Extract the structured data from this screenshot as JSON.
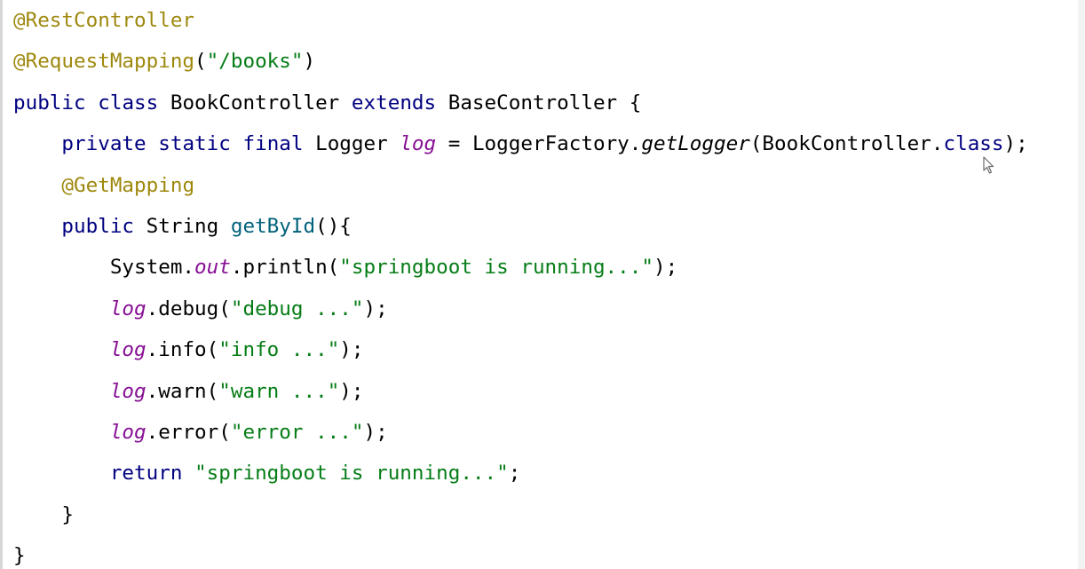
{
  "editor": {
    "lines": [
      [
        {
          "t": "@RestController",
          "c": "ann"
        }
      ],
      [
        {
          "t": "@RequestMapping",
          "c": "ann"
        },
        {
          "t": "(",
          "c": ""
        },
        {
          "t": "\"/books\"",
          "c": "str"
        },
        {
          "t": ")",
          "c": ""
        }
      ],
      [
        {
          "t": "public",
          "c": "kw"
        },
        {
          "t": " ",
          "c": ""
        },
        {
          "t": "class",
          "c": "kw"
        },
        {
          "t": " BookController ",
          "c": ""
        },
        {
          "t": "extends",
          "c": "kw"
        },
        {
          "t": " BaseController {",
          "c": ""
        }
      ],
      [
        {
          "t": "    ",
          "c": ""
        },
        {
          "t": "private",
          "c": "kw"
        },
        {
          "t": " ",
          "c": ""
        },
        {
          "t": "static",
          "c": "kw"
        },
        {
          "t": " ",
          "c": ""
        },
        {
          "t": "final",
          "c": "kw"
        },
        {
          "t": " Logger ",
          "c": ""
        },
        {
          "t": "log",
          "c": "fld"
        },
        {
          "t": " = LoggerFactory.",
          "c": ""
        },
        {
          "t": "getLogger",
          "c": "itl"
        },
        {
          "t": "(BookController.",
          "c": ""
        },
        {
          "t": "class",
          "c": "kw"
        },
        {
          "t": ");",
          "c": ""
        }
      ],
      [
        {
          "t": "    ",
          "c": ""
        },
        {
          "t": "@GetMapping",
          "c": "ann"
        }
      ],
      [
        {
          "t": "    ",
          "c": ""
        },
        {
          "t": "public",
          "c": "kw"
        },
        {
          "t": " String ",
          "c": ""
        },
        {
          "t": "getById",
          "c": "mth"
        },
        {
          "t": "(){",
          "c": ""
        }
      ],
      [
        {
          "t": "        System.",
          "c": ""
        },
        {
          "t": "out",
          "c": "fld"
        },
        {
          "t": ".println(",
          "c": ""
        },
        {
          "t": "\"springboot is running...\"",
          "c": "str"
        },
        {
          "t": ");",
          "c": ""
        }
      ],
      [
        {
          "t": "        ",
          "c": ""
        },
        {
          "t": "log",
          "c": "fld"
        },
        {
          "t": ".debug(",
          "c": ""
        },
        {
          "t": "\"debug ...\"",
          "c": "str"
        },
        {
          "t": ");",
          "c": ""
        }
      ],
      [
        {
          "t": "        ",
          "c": ""
        },
        {
          "t": "log",
          "c": "fld"
        },
        {
          "t": ".info(",
          "c": ""
        },
        {
          "t": "\"info ...\"",
          "c": "str"
        },
        {
          "t": ");",
          "c": ""
        }
      ],
      [
        {
          "t": "        ",
          "c": ""
        },
        {
          "t": "log",
          "c": "fld"
        },
        {
          "t": ".warn(",
          "c": ""
        },
        {
          "t": "\"warn ...\"",
          "c": "str"
        },
        {
          "t": ");",
          "c": ""
        }
      ],
      [
        {
          "t": "        ",
          "c": ""
        },
        {
          "t": "log",
          "c": "fld"
        },
        {
          "t": ".error(",
          "c": ""
        },
        {
          "t": "\"error ...\"",
          "c": "str"
        },
        {
          "t": ");",
          "c": ""
        }
      ],
      [
        {
          "t": "        ",
          "c": ""
        },
        {
          "t": "return",
          "c": "kw"
        },
        {
          "t": " ",
          "c": ""
        },
        {
          "t": "\"springboot is running...\"",
          "c": "str"
        },
        {
          "t": ";",
          "c": ""
        }
      ],
      [
        {
          "t": "    }",
          "c": ""
        }
      ],
      [
        {
          "t": "}",
          "c": ""
        }
      ]
    ]
  },
  "colors": {
    "annotation": "#9e880d",
    "keyword": "#000080",
    "string": "#067d17",
    "field": "#871094",
    "method": "#00627a"
  },
  "icons": {
    "cursor": "mouse-pointer-icon"
  }
}
